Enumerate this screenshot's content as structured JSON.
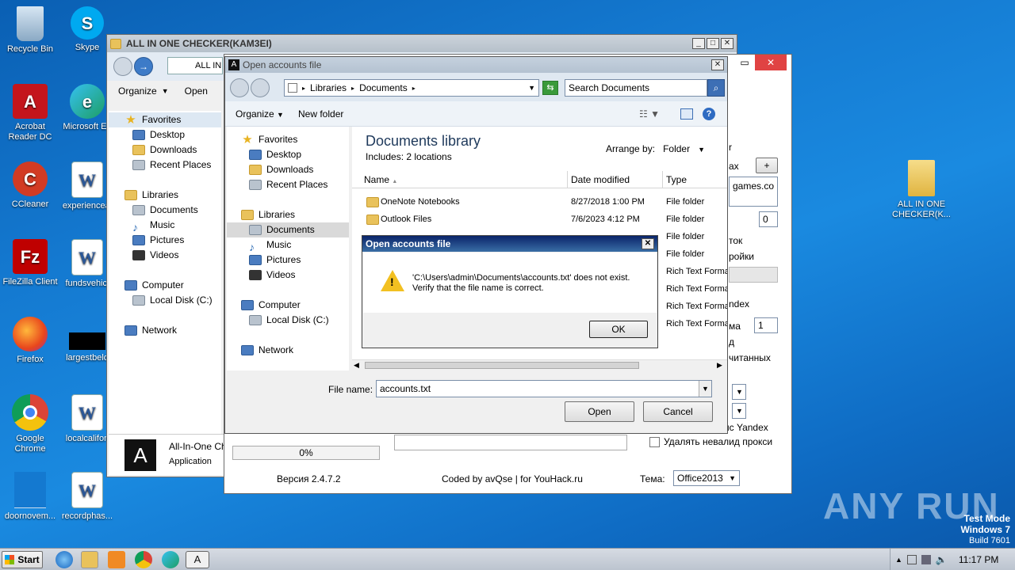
{
  "desktop": {
    "icons": [
      {
        "label": "Recycle Bin"
      },
      {
        "label": "Skype"
      },
      {
        "label": "Acrobat Reader DC"
      },
      {
        "label": "Microsoft Ed"
      },
      {
        "label": "CCleaner"
      },
      {
        "label": "experienceal"
      },
      {
        "label": "FileZilla Client"
      },
      {
        "label": "fundsvehicl"
      },
      {
        "label": "Firefox"
      },
      {
        "label": "largestbelo"
      },
      {
        "label": "Google Chrome"
      },
      {
        "label": "localcalifon"
      },
      {
        "label": "doornovem..."
      },
      {
        "label": "recordphas..."
      },
      {
        "label": "ALL IN ONE CHECKER(K..."
      }
    ],
    "watermark": "ANY RUN",
    "test_mode": [
      "Test Mode",
      "Windows 7",
      "Build 7601"
    ]
  },
  "explorer": {
    "title": "ALL IN ONE CHECKER(KAM3EI)",
    "address": "ALL IN",
    "organize": "Organize",
    "open": "Open",
    "nav": [
      "Favorites",
      "Desktop",
      "Downloads",
      "Recent Places",
      "Libraries",
      "Documents",
      "Music",
      "Pictures",
      "Videos",
      "Computer",
      "Local Disk (C:)",
      "Network"
    ],
    "item_name": "All-In-One Ch",
    "item_type": "Application"
  },
  "app": {
    "version": "Версия 2.4.7.2",
    "coded": "Coded by avQse | for YouHack.ru",
    "theme_label": "Тема:",
    "theme_value": "Office2013",
    "progress": "0%",
    "max_label": "ax",
    "plus": "+",
    "domain": "games.co",
    "spin1": "0",
    "tok": "ток",
    "roiki": "ройки",
    "yandex_head": "ndex",
    "ma": "ма",
    "spin2": "1",
    "d": "д",
    "chitannyh": "читанных",
    "yandex": "нс Yandex",
    "delete_proxy": "Удалять невалид прокси",
    "r": "r"
  },
  "open_dialog": {
    "title": "Open accounts file",
    "breadcrumb": [
      "Libraries",
      "Documents"
    ],
    "search_placeholder": "Search Documents",
    "organize": "Organize",
    "new_folder": "New folder",
    "nav": [
      "Favorites",
      "Desktop",
      "Downloads",
      "Recent Places",
      "Libraries",
      "Documents",
      "Music",
      "Pictures",
      "Videos",
      "Computer",
      "Local Disk (C:)",
      "Network"
    ],
    "library_title": "Documents library",
    "includes": "Includes:  2 locations",
    "arrange_label": "Arrange by:",
    "arrange_value": "Folder",
    "columns": [
      "Name",
      "Date modified",
      "Type"
    ],
    "files": [
      {
        "name": "OneNote Notebooks",
        "date": "8/27/2018 1:00 PM",
        "type": "File folder"
      },
      {
        "name": "Outlook Files",
        "date": "7/6/2023 4:12 PM",
        "type": "File folder"
      },
      {
        "name": "",
        "date": "",
        "type": "File folder"
      },
      {
        "name": "",
        "date": "",
        "type": "File folder"
      },
      {
        "name": "",
        "date": "",
        "type": "Rich Text Format"
      },
      {
        "name": "",
        "date": "",
        "type": "Rich Text Format"
      },
      {
        "name": "",
        "date": "",
        "type": "Rich Text Format"
      },
      {
        "name": "",
        "date": "",
        "type": "Rich Text Format"
      }
    ],
    "filename_label": "File name:",
    "filename_value": "accounts.txt",
    "open_btn": "Open",
    "cancel_btn": "Cancel"
  },
  "error_dialog": {
    "title": "Open accounts file",
    "line1": "'C:\\Users\\admin\\Documents\\accounts.txt' does not exist.",
    "line2": "Verify that the file name is correct.",
    "ok": "OK"
  },
  "taskbar": {
    "start": "Start",
    "time": "11:17 PM"
  }
}
